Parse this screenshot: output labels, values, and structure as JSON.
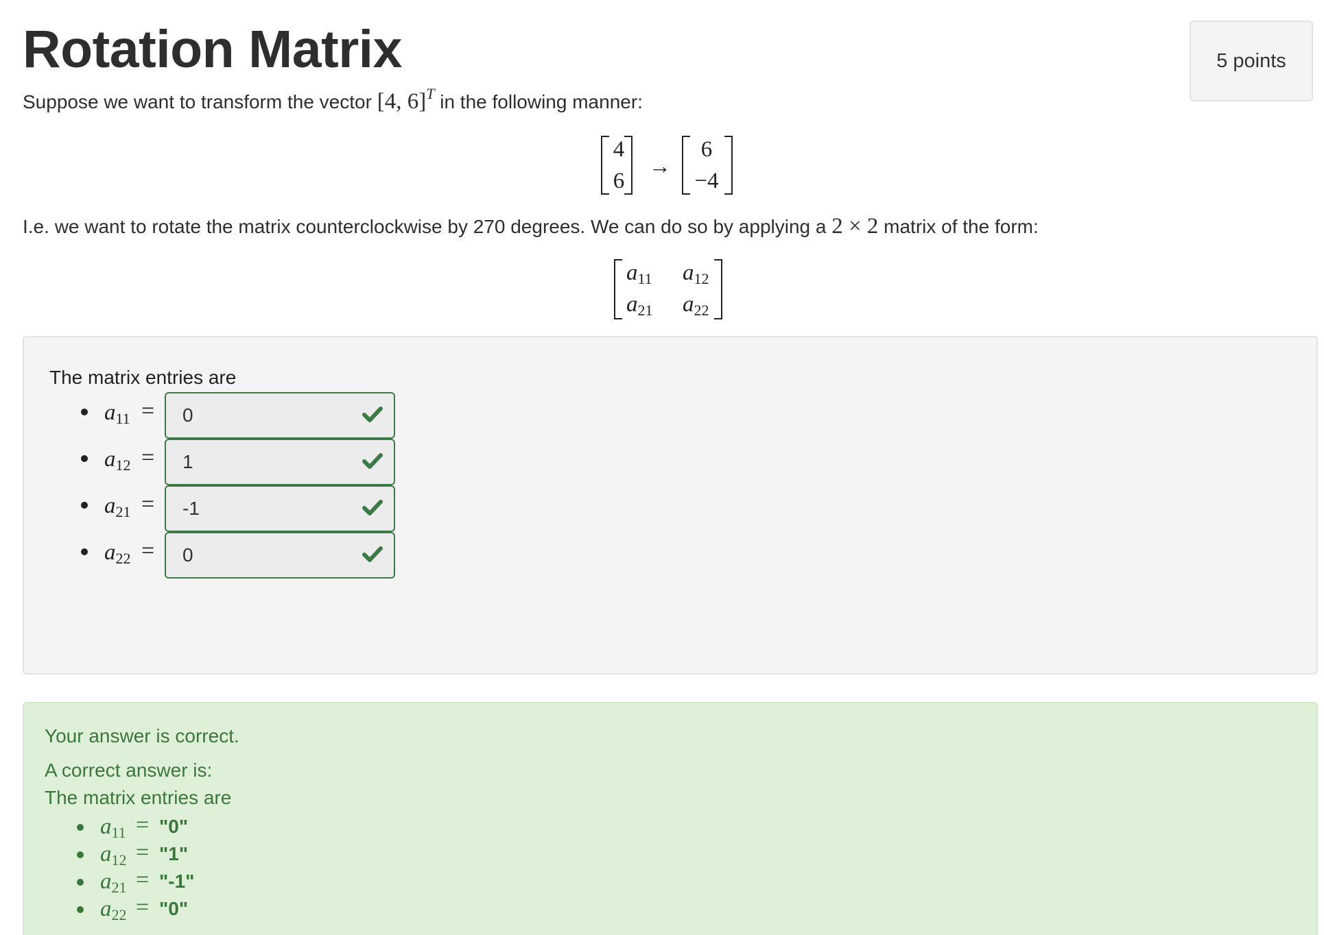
{
  "header": {
    "title": "Rotation Matrix",
    "points": "5 points"
  },
  "prompt": {
    "intro_before": "Suppose we want to transform the vector ",
    "vector_text": "[4, 6]",
    "vector_sup": "T",
    "intro_after": " in the following manner:",
    "transform": {
      "from": [
        "4",
        "6"
      ],
      "arrow": "→",
      "to": [
        "6",
        "−4"
      ]
    },
    "explain_before": "I.e. we want to rotate the matrix counterclockwise by 270 degrees. We can do so by applying a ",
    "explain_math": "2 × 2",
    "explain_after": " matrix of the form:",
    "matrix": {
      "a11": {
        "base": "a",
        "sub": "11"
      },
      "a12": {
        "base": "a",
        "sub": "12"
      },
      "a21": {
        "base": "a",
        "sub": "21"
      },
      "a22": {
        "base": "a",
        "sub": "22"
      }
    }
  },
  "question": {
    "label": "The matrix entries are",
    "entries": [
      {
        "var": "a",
        "sub": "11",
        "eq": "=",
        "value": "0",
        "status": "correct"
      },
      {
        "var": "a",
        "sub": "12",
        "eq": "=",
        "value": "1",
        "status": "correct"
      },
      {
        "var": "a",
        "sub": "21",
        "eq": "=",
        "value": "-1",
        "status": "correct"
      },
      {
        "var": "a",
        "sub": "22",
        "eq": "=",
        "value": "0",
        "status": "correct"
      }
    ]
  },
  "feedback": {
    "result": "Your answer is correct.",
    "correct_heading": "A correct answer is:",
    "label": "The matrix entries are",
    "answers": [
      {
        "var": "a",
        "sub": "11",
        "eq": "=",
        "value": "\"0\""
      },
      {
        "var": "a",
        "sub": "12",
        "eq": "=",
        "value": "\"1\""
      },
      {
        "var": "a",
        "sub": "21",
        "eq": "=",
        "value": "\"-1\""
      },
      {
        "var": "a",
        "sub": "22",
        "eq": "=",
        "value": "\"0\""
      }
    ]
  },
  "colors": {
    "success": "#3c763d",
    "success_bg": "#dff0d8",
    "input_border": "#3c7a45",
    "panel_bg": "#f4f4f4"
  }
}
